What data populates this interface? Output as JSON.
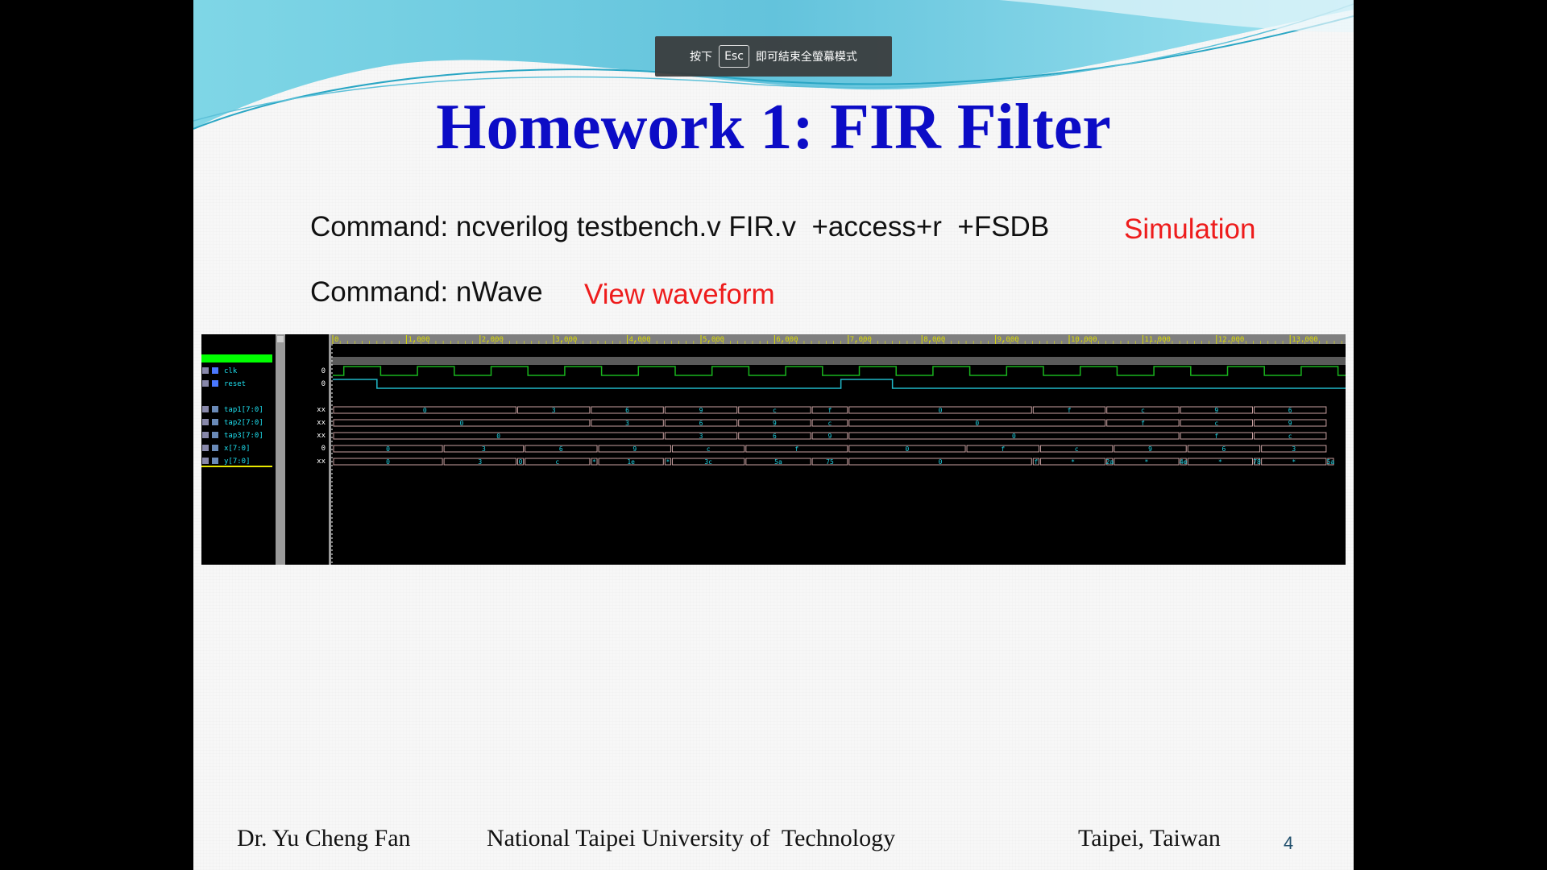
{
  "overlay": {
    "prefix": "按下",
    "key": "Esc",
    "suffix": "即可結束全螢幕模式"
  },
  "slide": {
    "title": "Homework 1: FIR Filter",
    "command1": "Command: ncverilog testbench.v FIR.v  +access+r  +FSDB",
    "label1": "Simulation",
    "command2": "Command: nWave",
    "label2": "View waveform",
    "footer": {
      "author": "Dr. Yu Cheng Fan",
      "university": "National Taipei University of  Technology",
      "place": "Taipei, Taiwan",
      "page": "4"
    }
  },
  "nwave": {
    "ruler": [
      "0",
      "1,000",
      "2,000",
      "3,000",
      "4,000",
      "5,000",
      "6,000",
      "7,000",
      "8,000",
      "9,000",
      "10,000",
      "11,000",
      "12,000",
      "13,000"
    ],
    "signals": [
      {
        "name": "clk",
        "value": "0",
        "type": "bit",
        "icon": "bit-signal-icon"
      },
      {
        "name": "reset",
        "value": "0",
        "type": "bit",
        "icon": "bit-signal-icon"
      },
      {
        "name": "tap1[7:0]",
        "value": "xx",
        "type": "bus",
        "icon": "bus-signal-icon",
        "segments": [
          [
            "0",
            0,
            2.5
          ],
          [
            "3",
            2.5,
            3.5
          ],
          [
            "6",
            3.5,
            4.5
          ],
          [
            "9",
            4.5,
            5.5
          ],
          [
            "c",
            5.5,
            6.5
          ],
          [
            "f",
            6.5,
            7
          ],
          [
            "0",
            7,
            9.5
          ],
          [
            "f",
            9.5,
            10.5
          ],
          [
            "c",
            10.5,
            11.5
          ],
          [
            "9",
            11.5,
            12.5
          ],
          [
            "6",
            12.5,
            13.5
          ]
        ]
      },
      {
        "name": "tap2[7:0]",
        "value": "xx",
        "type": "bus",
        "icon": "bus-signal-icon",
        "segments": [
          [
            "0",
            0,
            3.5
          ],
          [
            "3",
            3.5,
            4.5
          ],
          [
            "6",
            4.5,
            5.5
          ],
          [
            "9",
            5.5,
            6.5
          ],
          [
            "c",
            6.5,
            7
          ],
          [
            "0",
            7,
            10.5
          ],
          [
            "f",
            10.5,
            11.5
          ],
          [
            "c",
            11.5,
            12.5
          ],
          [
            "9",
            12.5,
            13.5
          ]
        ]
      },
      {
        "name": "tap3[7:0]",
        "value": "xx",
        "type": "bus",
        "icon": "bus-signal-icon",
        "segments": [
          [
            "0",
            0,
            4.5
          ],
          [
            "3",
            4.5,
            5.5
          ],
          [
            "6",
            5.5,
            6.5
          ],
          [
            "9",
            6.5,
            7
          ],
          [
            "0",
            7,
            11.5
          ],
          [
            "f",
            11.5,
            12.5
          ],
          [
            "c",
            12.5,
            13.5
          ]
        ]
      },
      {
        "name": "x[7:0]",
        "value": "0",
        "type": "bus",
        "icon": "bus-signal-icon",
        "segments": [
          [
            "0",
            0,
            1.5
          ],
          [
            "3",
            1.5,
            2.6
          ],
          [
            "6",
            2.6,
            3.6
          ],
          [
            "9",
            3.6,
            4.6
          ],
          [
            "c",
            4.6,
            5.6
          ],
          [
            "f",
            5.6,
            7
          ],
          [
            "0",
            7,
            8.6
          ],
          [
            "f",
            8.6,
            9.6
          ],
          [
            "c",
            9.6,
            10.6
          ],
          [
            "9",
            10.6,
            11.6
          ],
          [
            "6",
            11.6,
            12.6
          ],
          [
            "3",
            12.6,
            13.5
          ]
        ]
      },
      {
        "name": "y[7:0]",
        "value": "xx",
        "type": "bus",
        "icon": "bus-signal-icon",
        "segments": [
          [
            "0",
            0,
            1.5
          ],
          [
            "3",
            1.5,
            2.5
          ],
          [
            "0",
            2.5,
            2.6
          ],
          [
            "c",
            2.6,
            3.5
          ],
          [
            "*",
            3.5,
            3.6
          ],
          [
            "1e",
            3.6,
            4.5
          ],
          [
            "*",
            4.5,
            4.6
          ],
          [
            "3c",
            4.6,
            5.6
          ],
          [
            "5a",
            5.6,
            6.5
          ],
          [
            "75",
            6.5,
            7
          ],
          [
            "0",
            7,
            9.5
          ],
          [
            "f",
            9.5,
            9.6
          ],
          [
            "*",
            9.6,
            10.5
          ],
          [
            "2a",
            10.5,
            10.6
          ],
          [
            "*",
            10.6,
            11.5
          ],
          [
            "4e",
            11.5,
            11.6
          ],
          [
            "*",
            11.6,
            12.5
          ],
          [
            "78",
            12.5,
            12.6
          ],
          [
            "*",
            12.6,
            13.5
          ],
          [
            "5a",
            13.5,
            13.6
          ]
        ]
      }
    ],
    "colors": {
      "clk": "#19b41e",
      "reset": "#20b8c8",
      "bus": "#c8a0a0",
      "busText": "#20d0e0",
      "selection": "#00ff00",
      "ruler": "#dcdc00",
      "titleBlue": "#0c0cc6",
      "accentRed": "#ee1c1c"
    }
  }
}
